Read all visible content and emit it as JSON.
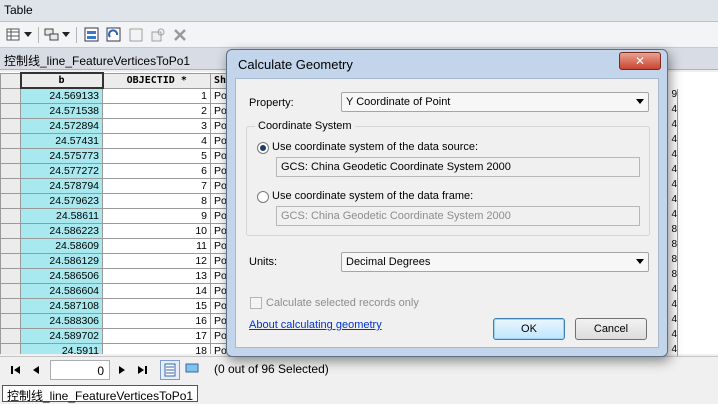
{
  "window": {
    "title": "Table"
  },
  "toolbar": {
    "buttons": [
      "table-options",
      "select-by-attributes",
      "switch-selection",
      "clear-selection",
      "zoom-to-selected",
      "delete-selected"
    ]
  },
  "layer_tab": {
    "label": "控制线_line_FeatureVerticesToPo1"
  },
  "table": {
    "columns": [
      "b",
      "OBJECTID *",
      "Sh"
    ],
    "rows": [
      {
        "b": "24.569133",
        "oid": "1",
        "shape": "Po"
      },
      {
        "b": "24.571538",
        "oid": "2",
        "shape": "Po"
      },
      {
        "b": "24.572894",
        "oid": "3",
        "shape": "Po"
      },
      {
        "b": "24.57431",
        "oid": "4",
        "shape": "Po"
      },
      {
        "b": "24.575773",
        "oid": "5",
        "shape": "Po"
      },
      {
        "b": "24.577272",
        "oid": "6",
        "shape": "Po"
      },
      {
        "b": "24.578794",
        "oid": "7",
        "shape": "Po"
      },
      {
        "b": "24.579623",
        "oid": "8",
        "shape": "Po"
      },
      {
        "b": "24.58611",
        "oid": "9",
        "shape": "Po"
      },
      {
        "b": "24.586223",
        "oid": "10",
        "shape": "Po"
      },
      {
        "b": "24.58609",
        "oid": "11",
        "shape": "Po"
      },
      {
        "b": "24.586129",
        "oid": "12",
        "shape": "Po"
      },
      {
        "b": "24.586506",
        "oid": "13",
        "shape": "Po"
      },
      {
        "b": "24.586604",
        "oid": "14",
        "shape": "Po"
      },
      {
        "b": "24.587108",
        "oid": "15",
        "shape": "Po"
      },
      {
        "b": "24.588306",
        "oid": "16",
        "shape": "Po"
      },
      {
        "b": "24.589702",
        "oid": "17",
        "shape": "Po"
      },
      {
        "b": "24.5911",
        "oid": "18",
        "shape": "Po"
      }
    ],
    "right_edge_digits": [
      "9",
      "4",
      "4",
      "4",
      "4",
      "4",
      "4",
      "4",
      "4",
      "8",
      "8",
      "8",
      "8",
      "4",
      "4",
      "4",
      "4",
      "4"
    ]
  },
  "status": {
    "record": "0",
    "selected_text": "(0 out of 96 Selected)"
  },
  "bottom_tab": {
    "label": "控制线_line_FeatureVerticesToPo1"
  },
  "dialog": {
    "title": "Calculate Geometry",
    "close_label": "✕",
    "property_label": "Property:",
    "property_value": "Y Coordinate of Point",
    "coord_group_label": "Coordinate System",
    "radio_source_label": "Use coordinate system of the data source:",
    "source_cs": "GCS: China Geodetic Coordinate System 2000",
    "radio_frame_label": "Use coordinate system of the data frame:",
    "frame_cs": "GCS: China Geodetic Coordinate System 2000",
    "units_label": "Units:",
    "units_value": "Decimal Degrees",
    "checkbox_label": "Calculate selected records only",
    "help_link": "About calculating geometry",
    "ok_label": "OK",
    "cancel_label": "Cancel"
  }
}
